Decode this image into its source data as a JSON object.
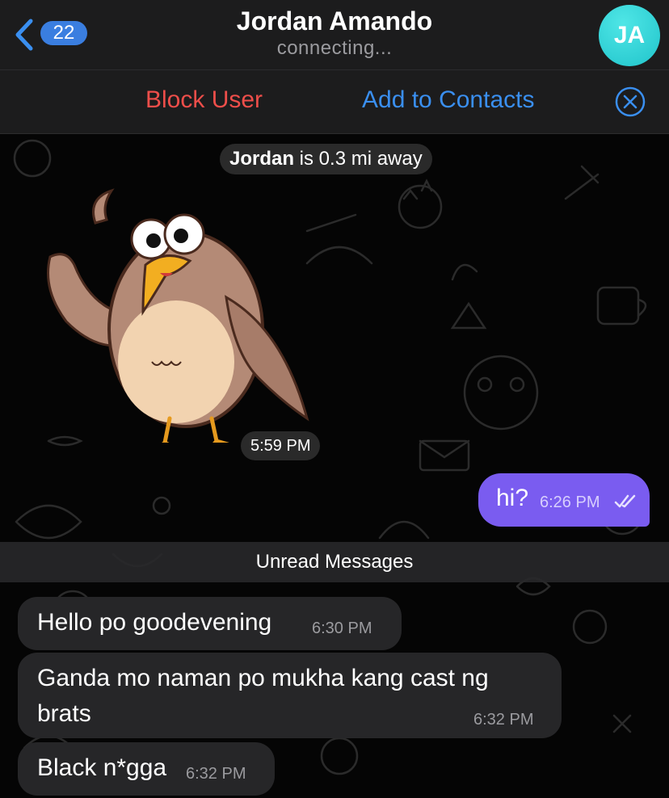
{
  "header": {
    "back_badge": "22",
    "title": "Jordan Amando",
    "subtitle": "connecting...",
    "avatar_initials": "JA"
  },
  "actions": {
    "block_label": "Block User",
    "add_contacts_label": "Add to Contacts",
    "block_color": "#ee4e4a",
    "link_color": "#3a8ff0"
  },
  "chat": {
    "distance_name": "Jordan",
    "distance_rest": " is 0.3 mi away",
    "sticker_time": "5:59 PM",
    "outgoing": {
      "text": "hi?",
      "time": "6:26 PM",
      "status": "read-double-check",
      "color": "#7a5cf0"
    },
    "unread_label": "Unread Messages",
    "incoming": [
      {
        "text": "Hello po goodevening",
        "time": "6:30 PM"
      },
      {
        "text": "Ganda mo naman po mukha kang cast ng brats",
        "line1": "Ganda mo naman po mukha kang cast ng",
        "line2": "brats",
        "time": "6:32 PM"
      },
      {
        "text": "Black n*gga",
        "time": "6:32 PM"
      }
    ]
  },
  "icons": {
    "back": "chevron-left-icon",
    "close": "close-circle-icon",
    "check": "double-check-icon",
    "sticker": "owl-sticker"
  }
}
